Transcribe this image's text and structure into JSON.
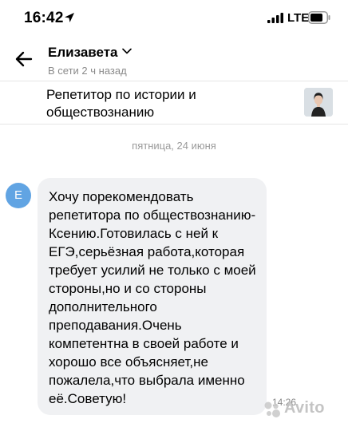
{
  "status_bar": {
    "time": "16:42",
    "network": "LTE",
    "icons": [
      "location-arrow-icon",
      "signal-icon",
      "battery-icon"
    ]
  },
  "header": {
    "back_icon": "arrow-left-icon",
    "contact_name": "Елизавета",
    "contact_status": "В сети 2 ч назад",
    "chevron_icon": "chevron-down-icon"
  },
  "ad": {
    "title": "Репетитор по истории и обществознанию",
    "thumbnail": "ad-photo"
  },
  "chat": {
    "date_separator": "пятница, 24 июня",
    "messages": [
      {
        "avatar_initial": "Е",
        "text": "Хочу порекомендовать\nрепетитора по обществознанию-\nКсению.Готовилась с ней к\nЕГЭ,серьёзная работа,которая\nтребует усилий не только с моей\nстороны,но и со стороны\nдополнительного\nпреподавания.Очень\nкомпетентна в своей работе и\nхорошо все объясняет,не\nпожалела,что выбрала именно\nеё.Советую!",
        "time": "14:26"
      }
    ]
  },
  "watermark": {
    "text": "Avito"
  },
  "colors": {
    "avatar_bg": "#61a4e3",
    "bubble_bg": "#f0f1f3",
    "muted_text": "#8a8a8a",
    "divider": "#e6e6e6"
  }
}
